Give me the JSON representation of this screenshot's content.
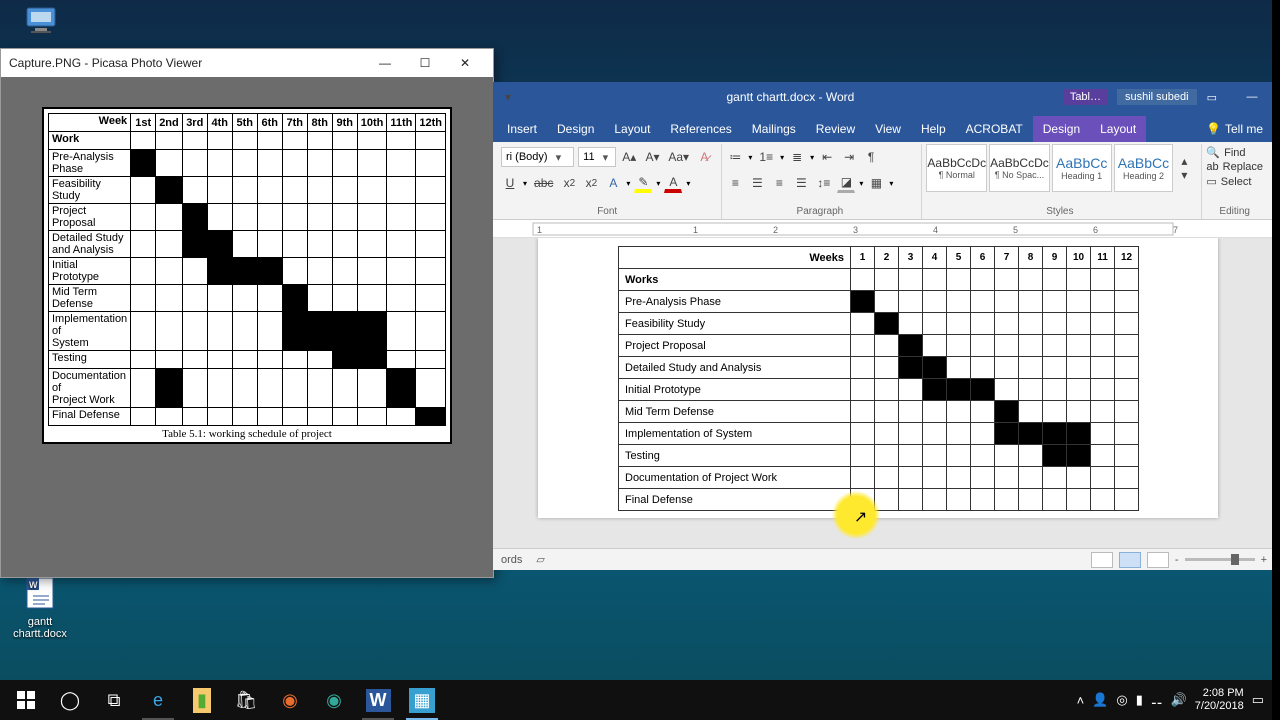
{
  "desktop": {
    "icons": [
      {
        "label": "This PC"
      },
      {
        "label": "gantt chartt.docx"
      }
    ]
  },
  "picasa": {
    "title": "Capture.PNG - Picasa Photo Viewer",
    "caption": "Table 5.1: working schedule of project",
    "header_first": "Week",
    "header_row_sub": "Work",
    "weeks": [
      "1st",
      "2nd",
      "3rd",
      "4th",
      "5th",
      "6th",
      "7th",
      "8th",
      "9th",
      "10th",
      "11th",
      "12th"
    ]
  },
  "word": {
    "doc_title": "gantt chartt.docx - Word",
    "context_tab": "Tabl…",
    "user": "sushil subedi",
    "tabs": [
      "Insert",
      "Design",
      "Layout",
      "References",
      "Mailings",
      "Review",
      "View",
      "Help",
      "ACROBAT"
    ],
    "ctx_tabs": [
      "Design",
      "Layout"
    ],
    "tell_me": "Tell me",
    "font": {
      "name": "ri (Body)",
      "size": "11"
    },
    "style_boxes": [
      {
        "preview": "AaBbCcDc",
        "label": "¶ Normal",
        "h": false
      },
      {
        "preview": "AaBbCcDc",
        "label": "¶ No Spac...",
        "h": false
      },
      {
        "preview": "AaBbCc",
        "label": "Heading 1",
        "h": true
      },
      {
        "preview": "AaBbCc",
        "label": "Heading 2",
        "h": true
      }
    ],
    "groups": {
      "font": "Font",
      "para": "Paragraph",
      "styles": "Styles",
      "editing": "Editing"
    },
    "editing": {
      "find": "Find",
      "replace": "Replace",
      "select": "Select"
    },
    "status": {
      "words": "ords"
    },
    "table_header": "Weeks",
    "table_first": "Works",
    "weeks": [
      "1",
      "2",
      "3",
      "4",
      "5",
      "6",
      "7",
      "8",
      "9",
      "10",
      "11",
      "12"
    ]
  },
  "chart_data": {
    "type": "table",
    "title": "Table 5.1: working schedule of project",
    "xlabel": "Week",
    "ylabel": "Work",
    "categories": [
      "1",
      "2",
      "3",
      "4",
      "5",
      "6",
      "7",
      "8",
      "9",
      "10",
      "11",
      "12"
    ],
    "series": [
      {
        "name": "Pre-Analysis Phase",
        "values": [
          1,
          0,
          0,
          0,
          0,
          0,
          0,
          0,
          0,
          0,
          0,
          0
        ]
      },
      {
        "name": "Feasibility Study",
        "values": [
          0,
          1,
          0,
          0,
          0,
          0,
          0,
          0,
          0,
          0,
          0,
          0
        ]
      },
      {
        "name": "Project Proposal",
        "values": [
          0,
          0,
          1,
          0,
          0,
          0,
          0,
          0,
          0,
          0,
          0,
          0
        ]
      },
      {
        "name": "Detailed Study and Analysis",
        "values": [
          0,
          0,
          1,
          1,
          0,
          0,
          0,
          0,
          0,
          0,
          0,
          0
        ]
      },
      {
        "name": "Initial Prototype",
        "values": [
          0,
          0,
          0,
          1,
          1,
          1,
          0,
          0,
          0,
          0,
          0,
          0
        ]
      },
      {
        "name": "Mid Term Defense",
        "values": [
          0,
          0,
          0,
          0,
          0,
          0,
          1,
          0,
          0,
          0,
          0,
          0
        ]
      },
      {
        "name": "Implementation of System",
        "values": [
          0,
          0,
          0,
          0,
          0,
          0,
          1,
          1,
          1,
          1,
          0,
          0
        ]
      },
      {
        "name": "Testing",
        "values": [
          0,
          0,
          0,
          0,
          0,
          0,
          0,
          0,
          1,
          1,
          0,
          0
        ]
      },
      {
        "name": "Documentation of Project Work",
        "values": [
          0,
          1,
          0,
          0,
          0,
          0,
          0,
          0,
          0,
          0,
          1,
          0
        ]
      },
      {
        "name": "Final Defense",
        "values": [
          0,
          0,
          0,
          0,
          0,
          0,
          0,
          0,
          0,
          0,
          0,
          1
        ]
      }
    ]
  },
  "taskbar": {
    "clock_time": "2:08 PM",
    "clock_date": "7/20/2018"
  }
}
